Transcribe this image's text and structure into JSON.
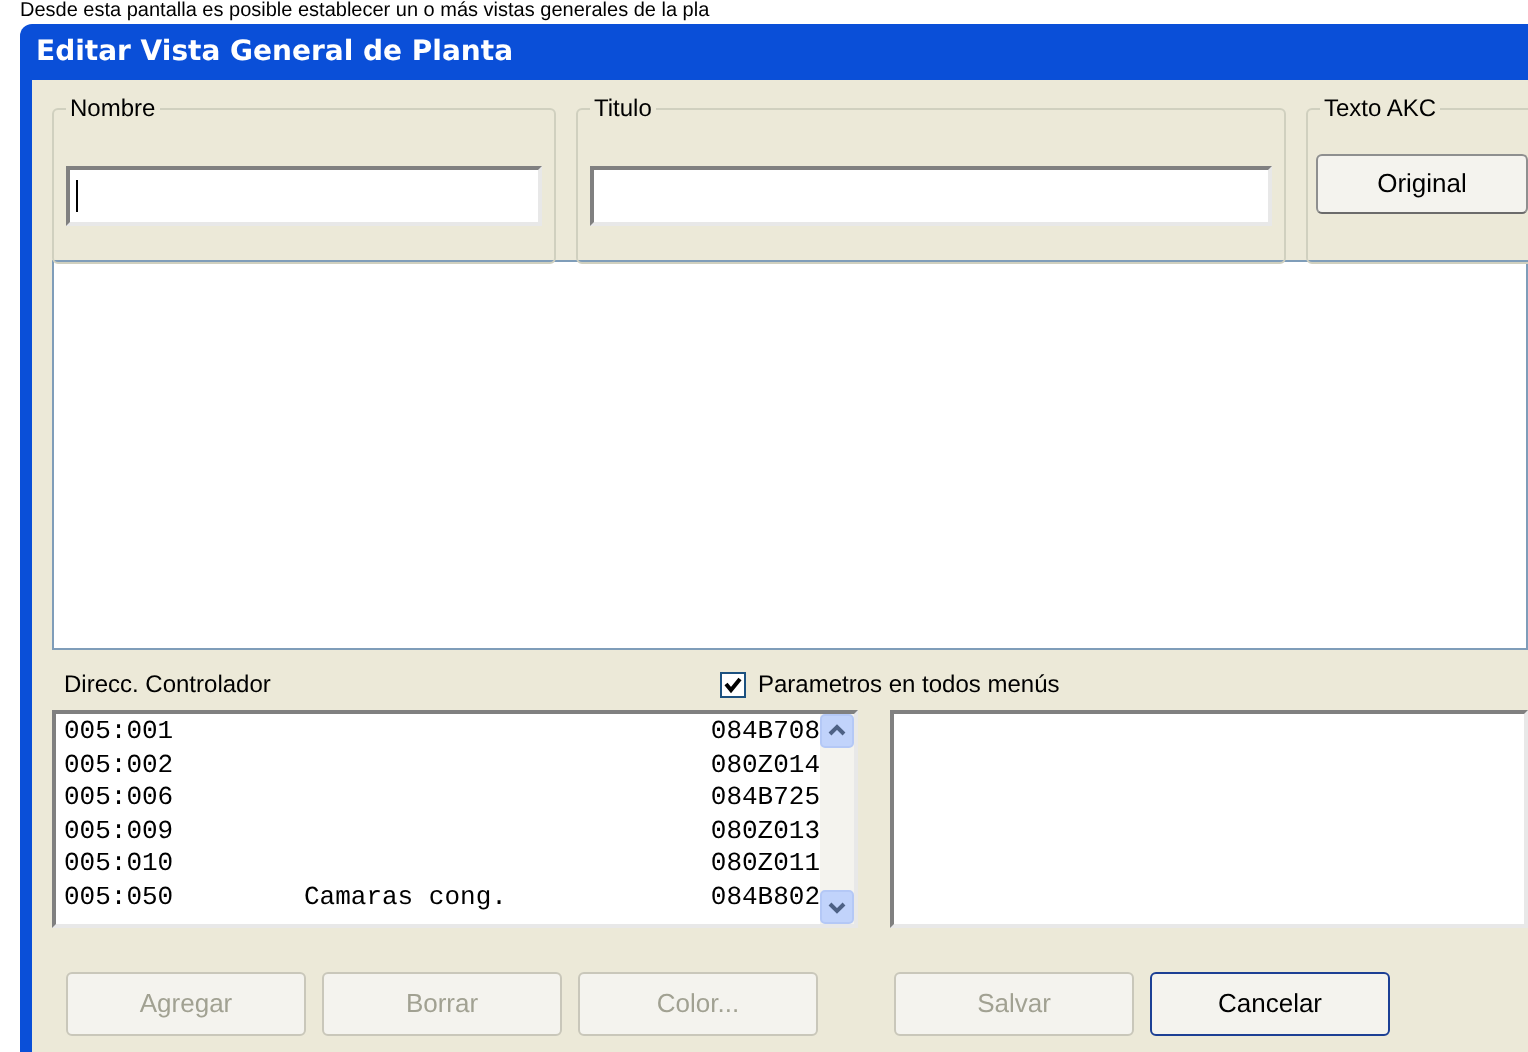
{
  "caption": "Desde esta pantalla es posible establecer un o más vistas generales de la pla",
  "window": {
    "title": "Editar Vista General de Planta"
  },
  "groups": [
    {
      "kind": "field",
      "label": "Nombre",
      "focused": true
    },
    {
      "kind": "field",
      "label": "Titulo",
      "focused": false
    },
    {
      "kind": "button",
      "label": "Texto AKC",
      "button": "Original"
    }
  ],
  "controller_label": "Direcc. Controlador",
  "checkbox": {
    "label": "Parametros en todos menús",
    "checked": true
  },
  "list": [
    {
      "address": "005:001",
      "code": "084B708"
    },
    {
      "address": "005:002",
      "code": "080Z014"
    },
    {
      "address": "005:006",
      "code": "084B725"
    },
    {
      "address": "005:009",
      "code": "080Z013"
    },
    {
      "address": "005:010",
      "code": "080Z011"
    },
    {
      "address": "005:050",
      "name": "Camaras cong.",
      "code": "084B802"
    }
  ],
  "buttons": [
    {
      "label": "Agregar",
      "disabled": true
    },
    {
      "label": "Borrar",
      "disabled": true
    },
    {
      "label": "Color...",
      "disabled": true
    },
    {
      "label": "Salvar",
      "disabled": true
    },
    {
      "label": "Cancelar",
      "disabled": false
    }
  ]
}
